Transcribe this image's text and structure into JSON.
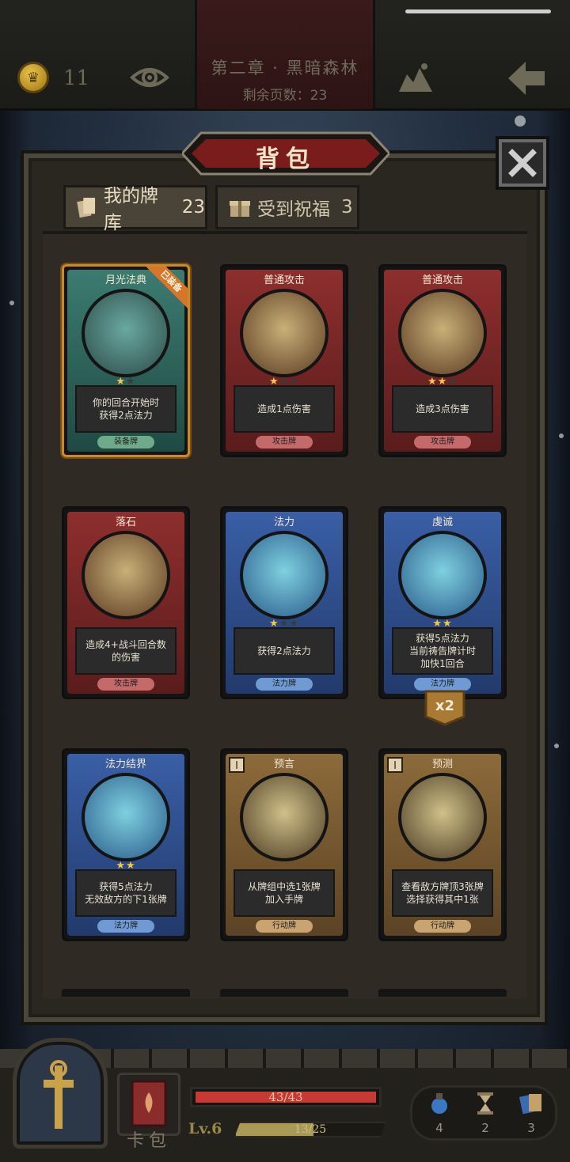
{
  "header": {
    "gold": "11",
    "chapter_title": "第二章 · 黑暗森林",
    "pages_remaining": "剩余页数：23"
  },
  "panel": {
    "title": "背包",
    "tabs": [
      {
        "label": "我的牌库",
        "count": "23",
        "icon": "cards-icon"
      },
      {
        "label": "受到祝福",
        "count": "3",
        "icon": "gift-icon"
      }
    ]
  },
  "cards": [
    {
      "name": "月光法典",
      "stars": 1,
      "max_stars": 2,
      "desc": "你的回合开始时\n获得2点法力",
      "type": "装备牌",
      "color": "teal",
      "equipped_label": "已装备"
    },
    {
      "name": "普通攻击",
      "stars": 1,
      "max_stars": 3,
      "desc": "造成1点伤害",
      "type": "攻击牌",
      "color": "red"
    },
    {
      "name": "普通攻击",
      "stars": 2,
      "max_stars": 3,
      "desc": "造成3点伤害",
      "type": "攻击牌",
      "color": "red"
    },
    {
      "name": "落石",
      "stars": 0,
      "max_stars": 0,
      "desc": "造成4+战斗回合数\n的伤害",
      "type": "攻击牌",
      "color": "red"
    },
    {
      "name": "法力",
      "stars": 1,
      "max_stars": 3,
      "desc": "获得2点法力",
      "type": "法力牌",
      "color": "blue"
    },
    {
      "name": "虔诚",
      "stars": 2,
      "max_stars": 2,
      "desc": "获得5点法力\n当前祷告牌计时\n加快1回合",
      "type": "法力牌",
      "color": "blue",
      "multiplier": "x2"
    },
    {
      "name": "法力结界",
      "stars": 2,
      "max_stars": 2,
      "desc": "获得5点法力\n无效敌方的下1张牌",
      "type": "法力牌",
      "color": "blue"
    },
    {
      "name": "预言",
      "stars": 0,
      "max_stars": 0,
      "desc": "从牌组中选1张牌\n加入手牌",
      "type": "行动牌",
      "color": "gold",
      "hourglass": "I"
    },
    {
      "name": "预测",
      "stars": 0,
      "max_stars": 0,
      "desc": "查看敌方牌顶3张牌\n选择获得其中1张",
      "type": "行动牌",
      "color": "gold",
      "hourglass": "I"
    }
  ],
  "bottom": {
    "bag_label": "卡包",
    "hp_text": "43/43",
    "hp_fraction": 1.0,
    "level_label": "Lv.6",
    "xp_text": "13/25",
    "xp_fraction": 0.52,
    "resources": [
      {
        "icon": "potion-icon",
        "count": "4"
      },
      {
        "icon": "hourglass-icon",
        "count": "2"
      },
      {
        "icon": "cards-icon",
        "count": "3"
      }
    ]
  },
  "colors": {
    "accent_gold": "#c88a2a",
    "hp_red": "#c73a34",
    "xp_gold": "#a99a55"
  }
}
